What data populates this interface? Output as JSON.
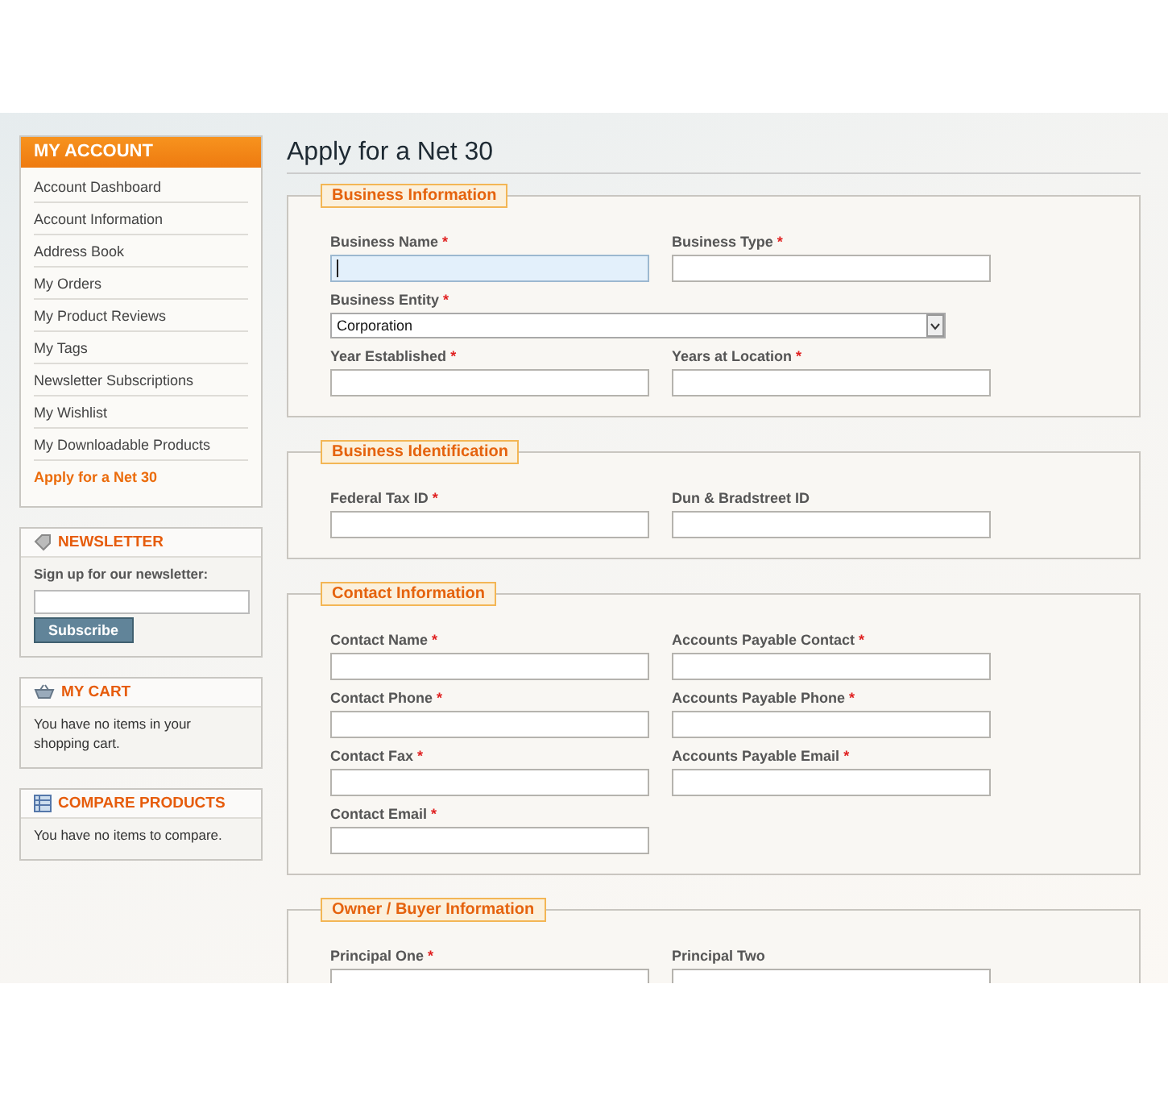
{
  "sidebar": {
    "account": {
      "title": "MY ACCOUNT",
      "items": [
        {
          "label": "Account Dashboard",
          "selected": false
        },
        {
          "label": "Account Information",
          "selected": false
        },
        {
          "label": "Address Book",
          "selected": false
        },
        {
          "label": "My Orders",
          "selected": false
        },
        {
          "label": "My Product Reviews",
          "selected": false
        },
        {
          "label": "My Tags",
          "selected": false
        },
        {
          "label": "Newsletter Subscriptions",
          "selected": false
        },
        {
          "label": "My Wishlist",
          "selected": false
        },
        {
          "label": "My Downloadable Products",
          "selected": false
        },
        {
          "label": "Apply for a Net 30",
          "selected": true
        }
      ]
    },
    "newsletter": {
      "title": "NEWSLETTER",
      "label": "Sign up for our newsletter:",
      "button": "Subscribe"
    },
    "cart": {
      "title": "MY CART",
      "text": "You have no items in your shopping cart."
    },
    "compare": {
      "title": "COMPARE PRODUCTS",
      "text": "You have no items to compare."
    }
  },
  "page_title": "Apply for a Net 30",
  "required_mark": "*",
  "sections": [
    {
      "legend": "Business Information",
      "fields": [
        {
          "label": "Business Name",
          "required": true,
          "kind": "text",
          "focused": true
        },
        {
          "label": "Business Type",
          "required": true,
          "kind": "text",
          "focused": false
        },
        {
          "label": "Business Entity",
          "required": true,
          "kind": "select",
          "value": "Corporation"
        },
        {
          "label": "Year Established",
          "required": true,
          "kind": "text",
          "focused": false
        },
        {
          "label": "Years at Location",
          "required": true,
          "kind": "text",
          "focused": false
        }
      ]
    },
    {
      "legend": "Business Identification",
      "fields": [
        {
          "label": "Federal Tax ID",
          "required": true,
          "kind": "text",
          "focused": false
        },
        {
          "label": "Dun & Bradstreet ID",
          "required": false,
          "kind": "text",
          "focused": false
        }
      ]
    },
    {
      "legend": "Contact Information",
      "fields": [
        {
          "label": "Contact Name",
          "required": true,
          "kind": "text",
          "focused": false
        },
        {
          "label": "Accounts Payable Contact",
          "required": true,
          "kind": "text",
          "focused": false
        },
        {
          "label": "Contact Phone",
          "required": true,
          "kind": "text",
          "focused": false
        },
        {
          "label": "Accounts Payable Phone",
          "required": true,
          "kind": "text",
          "focused": false
        },
        {
          "label": "Contact Fax",
          "required": true,
          "kind": "text",
          "focused": false
        },
        {
          "label": "Accounts Payable Email",
          "required": true,
          "kind": "text",
          "focused": false
        },
        {
          "label": "Contact Email",
          "required": true,
          "kind": "text",
          "focused": false
        }
      ]
    },
    {
      "legend": "Owner / Buyer Information",
      "fields": [
        {
          "label": "Principal One",
          "required": true,
          "kind": "text",
          "focused": false
        },
        {
          "label": "Principal Two",
          "required": false,
          "kind": "text",
          "focused": false
        }
      ]
    }
  ]
}
